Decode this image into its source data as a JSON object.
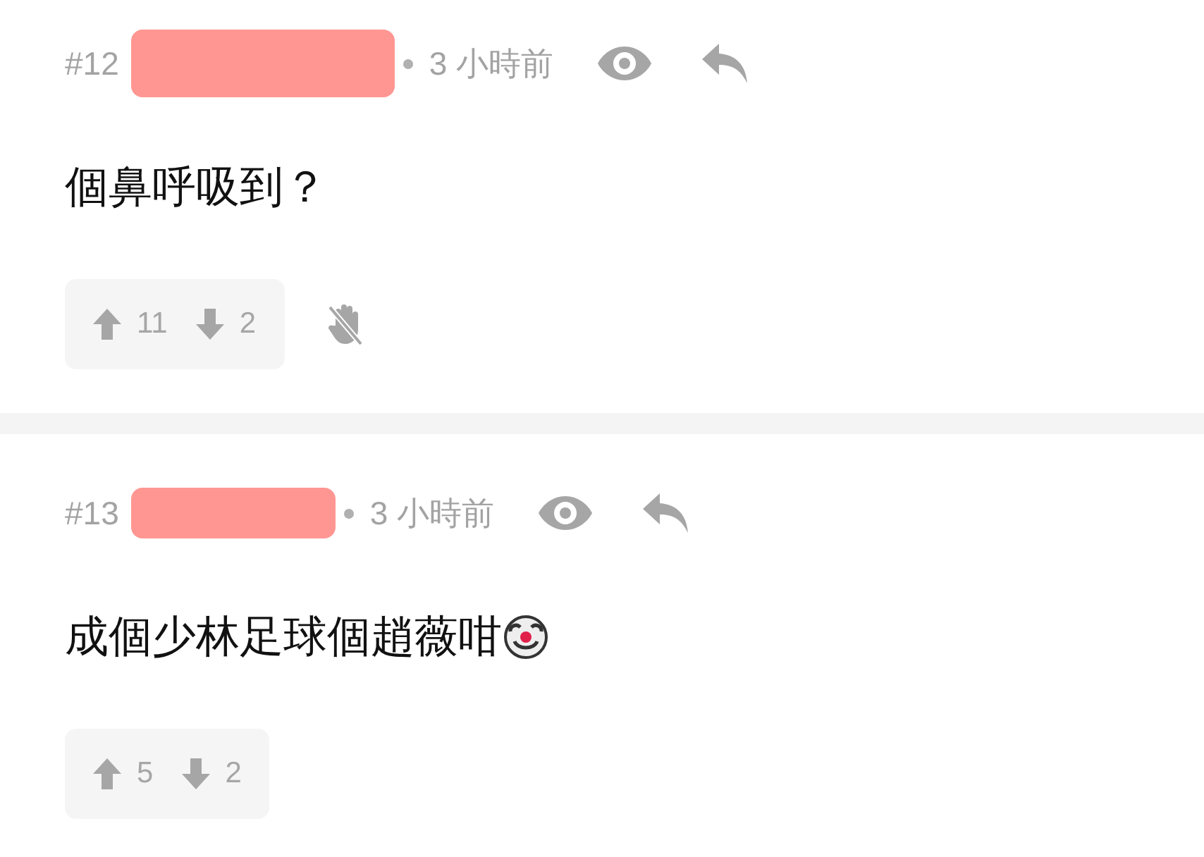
{
  "posts": [
    {
      "number": "#12",
      "author_redacted": true,
      "time": "3 小時前",
      "text": "個鼻呼吸到？",
      "clown_emoji": false,
      "upvotes": "11",
      "downvotes": "2",
      "block_button": true
    },
    {
      "number": "#13",
      "author_redacted": true,
      "time": "3 小時前",
      "text": "成個少林足球個趙薇咁",
      "clown_emoji": true,
      "upvotes": "5",
      "downvotes": "2",
      "block_button": false
    }
  ]
}
